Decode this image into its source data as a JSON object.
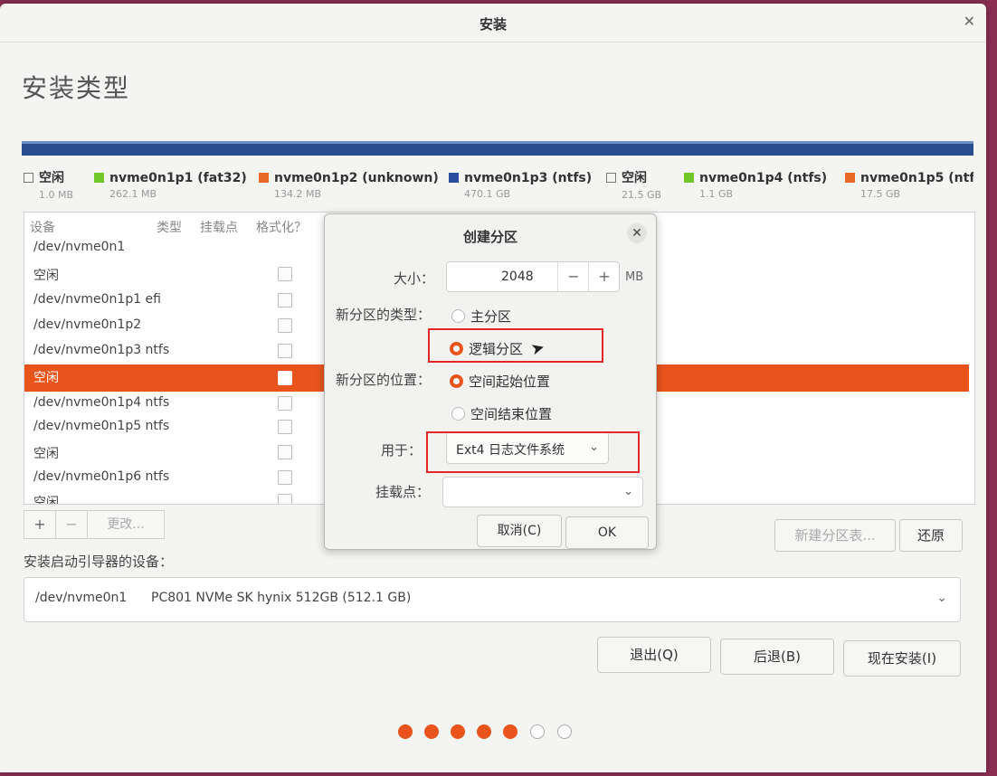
{
  "window": {
    "title": "安装"
  },
  "page": {
    "heading": "安装类型"
  },
  "legend": [
    {
      "name": "空闲",
      "size": "1.0 MB",
      "color": "#ffffff"
    },
    {
      "name": "nvme0n1p1 (fat32)",
      "size": "262.1 MB",
      "color": "#73c62a"
    },
    {
      "name": "nvme0n1p2 (unknown)",
      "size": "134.2 MB",
      "color": "#e86a24"
    },
    {
      "name": "nvme0n1p3 (ntfs)",
      "size": "470.1 GB",
      "color": "#2a4d9f"
    },
    {
      "name": "空闲",
      "size": "21.5 GB",
      "color": "#ffffff"
    },
    {
      "name": "nvme0n1p4 (ntfs)",
      "size": "1.1 GB",
      "color": "#73c62a"
    },
    {
      "name": "nvme0n1p5 (ntf",
      "size": "17.5 GB",
      "color": "#e86a24"
    }
  ],
  "table": {
    "headers": {
      "device": "设备",
      "type": "类型",
      "mount": "挂载点",
      "format": "格式化？"
    },
    "rows": [
      {
        "device": "/dev/nvme0n1",
        "has_check": false,
        "selected": false
      },
      {
        "device": "空闲",
        "has_check": true,
        "selected": false
      },
      {
        "device": "/dev/nvme0n1p1  efi",
        "has_check": true,
        "selected": false
      },
      {
        "device": "/dev/nvme0n1p2",
        "has_check": true,
        "selected": false
      },
      {
        "device": "/dev/nvme0n1p3  ntfs",
        "has_check": true,
        "selected": false
      },
      {
        "device": "空闲",
        "has_check": true,
        "selected": true
      },
      {
        "device": "/dev/nvme0n1p4  ntfs",
        "has_check": true,
        "selected": false
      },
      {
        "device": "/dev/nvme0n1p5  ntfs",
        "has_check": true,
        "selected": false
      },
      {
        "device": "空闲",
        "has_check": true,
        "selected": false
      },
      {
        "device": "/dev/nvme0n1p6  ntfs",
        "has_check": true,
        "selected": false
      },
      {
        "device": "空闲",
        "has_check": true,
        "selected": false
      }
    ]
  },
  "toolbar": {
    "add": "+",
    "remove": "−",
    "change": "更改..."
  },
  "buttons": {
    "new_table": "新建分区表...",
    "revert": "还原",
    "quit": "退出(Q)",
    "back": "后退(B)",
    "install_now": "现在安装(I)"
  },
  "boot": {
    "label": "安装启动引导器的设备：",
    "device": "/dev/nvme0n1",
    "description": "PC801 NVMe SK hynix 512GB (512.1 GB)"
  },
  "progress": {
    "total_steps": 7,
    "current_step": 5
  },
  "dialog": {
    "title": "创建分区",
    "size_label": "大小：",
    "size_value": "2048",
    "minus": "−",
    "plus": "+",
    "size_unit": "MB",
    "type_label": "新分区的类型：",
    "type_primary": "主分区",
    "type_logical": "逻辑分区",
    "location_label": "新分区的位置：",
    "location_start": "空间起始位置",
    "location_end": "空间结束位置",
    "use_label": "用于：",
    "use_value": "Ext4 日志文件系统",
    "mount_label": "挂载点：",
    "mount_value": "",
    "cancel": "取消(C)",
    "ok": "OK"
  },
  "highlight_color": "#e5252c",
  "accent_color": "#e9541d"
}
